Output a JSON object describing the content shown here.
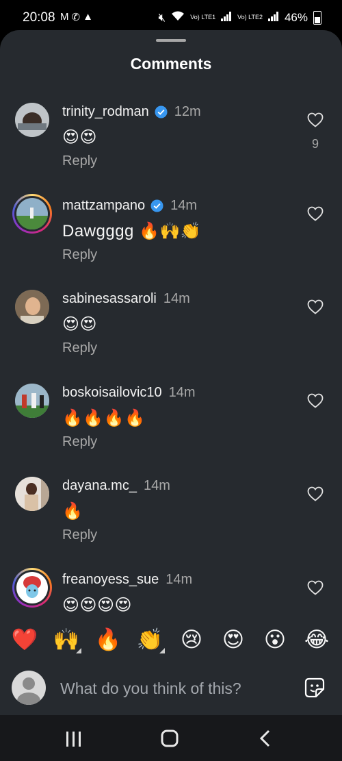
{
  "status_bar": {
    "time": "20:08",
    "battery": "46%",
    "lte1": "Vo) LTE1",
    "lte2": "Vo) LTE2"
  },
  "sheet": {
    "title": "Comments"
  },
  "comments": [
    {
      "username": "trinity_rodman",
      "verified": true,
      "time": "12m",
      "text": "😍😍",
      "reply": "Reply",
      "likes": "9"
    },
    {
      "username": "mattzampano",
      "verified": true,
      "time": "14m",
      "text": "Dawgggg 🔥🙌👏",
      "reply": "Reply",
      "likes": ""
    },
    {
      "username": "sabinesassaroli",
      "verified": false,
      "time": "14m",
      "text": "😍😍",
      "reply": "Reply",
      "likes": ""
    },
    {
      "username": "boskoisailovic10",
      "verified": false,
      "time": "14m",
      "text": "🔥🔥🔥🔥",
      "reply": "Reply",
      "likes": ""
    },
    {
      "username": "dayana.mc_",
      "verified": false,
      "time": "14m",
      "text": "🔥",
      "reply": "Reply",
      "likes": ""
    },
    {
      "username": "freanoyess_sue",
      "verified": false,
      "time": "14m",
      "text": "😍😍😍😍",
      "reply": "",
      "likes": ""
    }
  ],
  "reactions": [
    "❤️",
    "🙌",
    "🔥",
    "👏",
    "😢",
    "😍",
    "😮",
    "😂"
  ],
  "composer": {
    "placeholder": "What do you think of this?"
  },
  "colors": {
    "sheet_bg": "#262a2f",
    "verified_blue": "#3897f0",
    "muted_text": "#a8a8a8"
  }
}
